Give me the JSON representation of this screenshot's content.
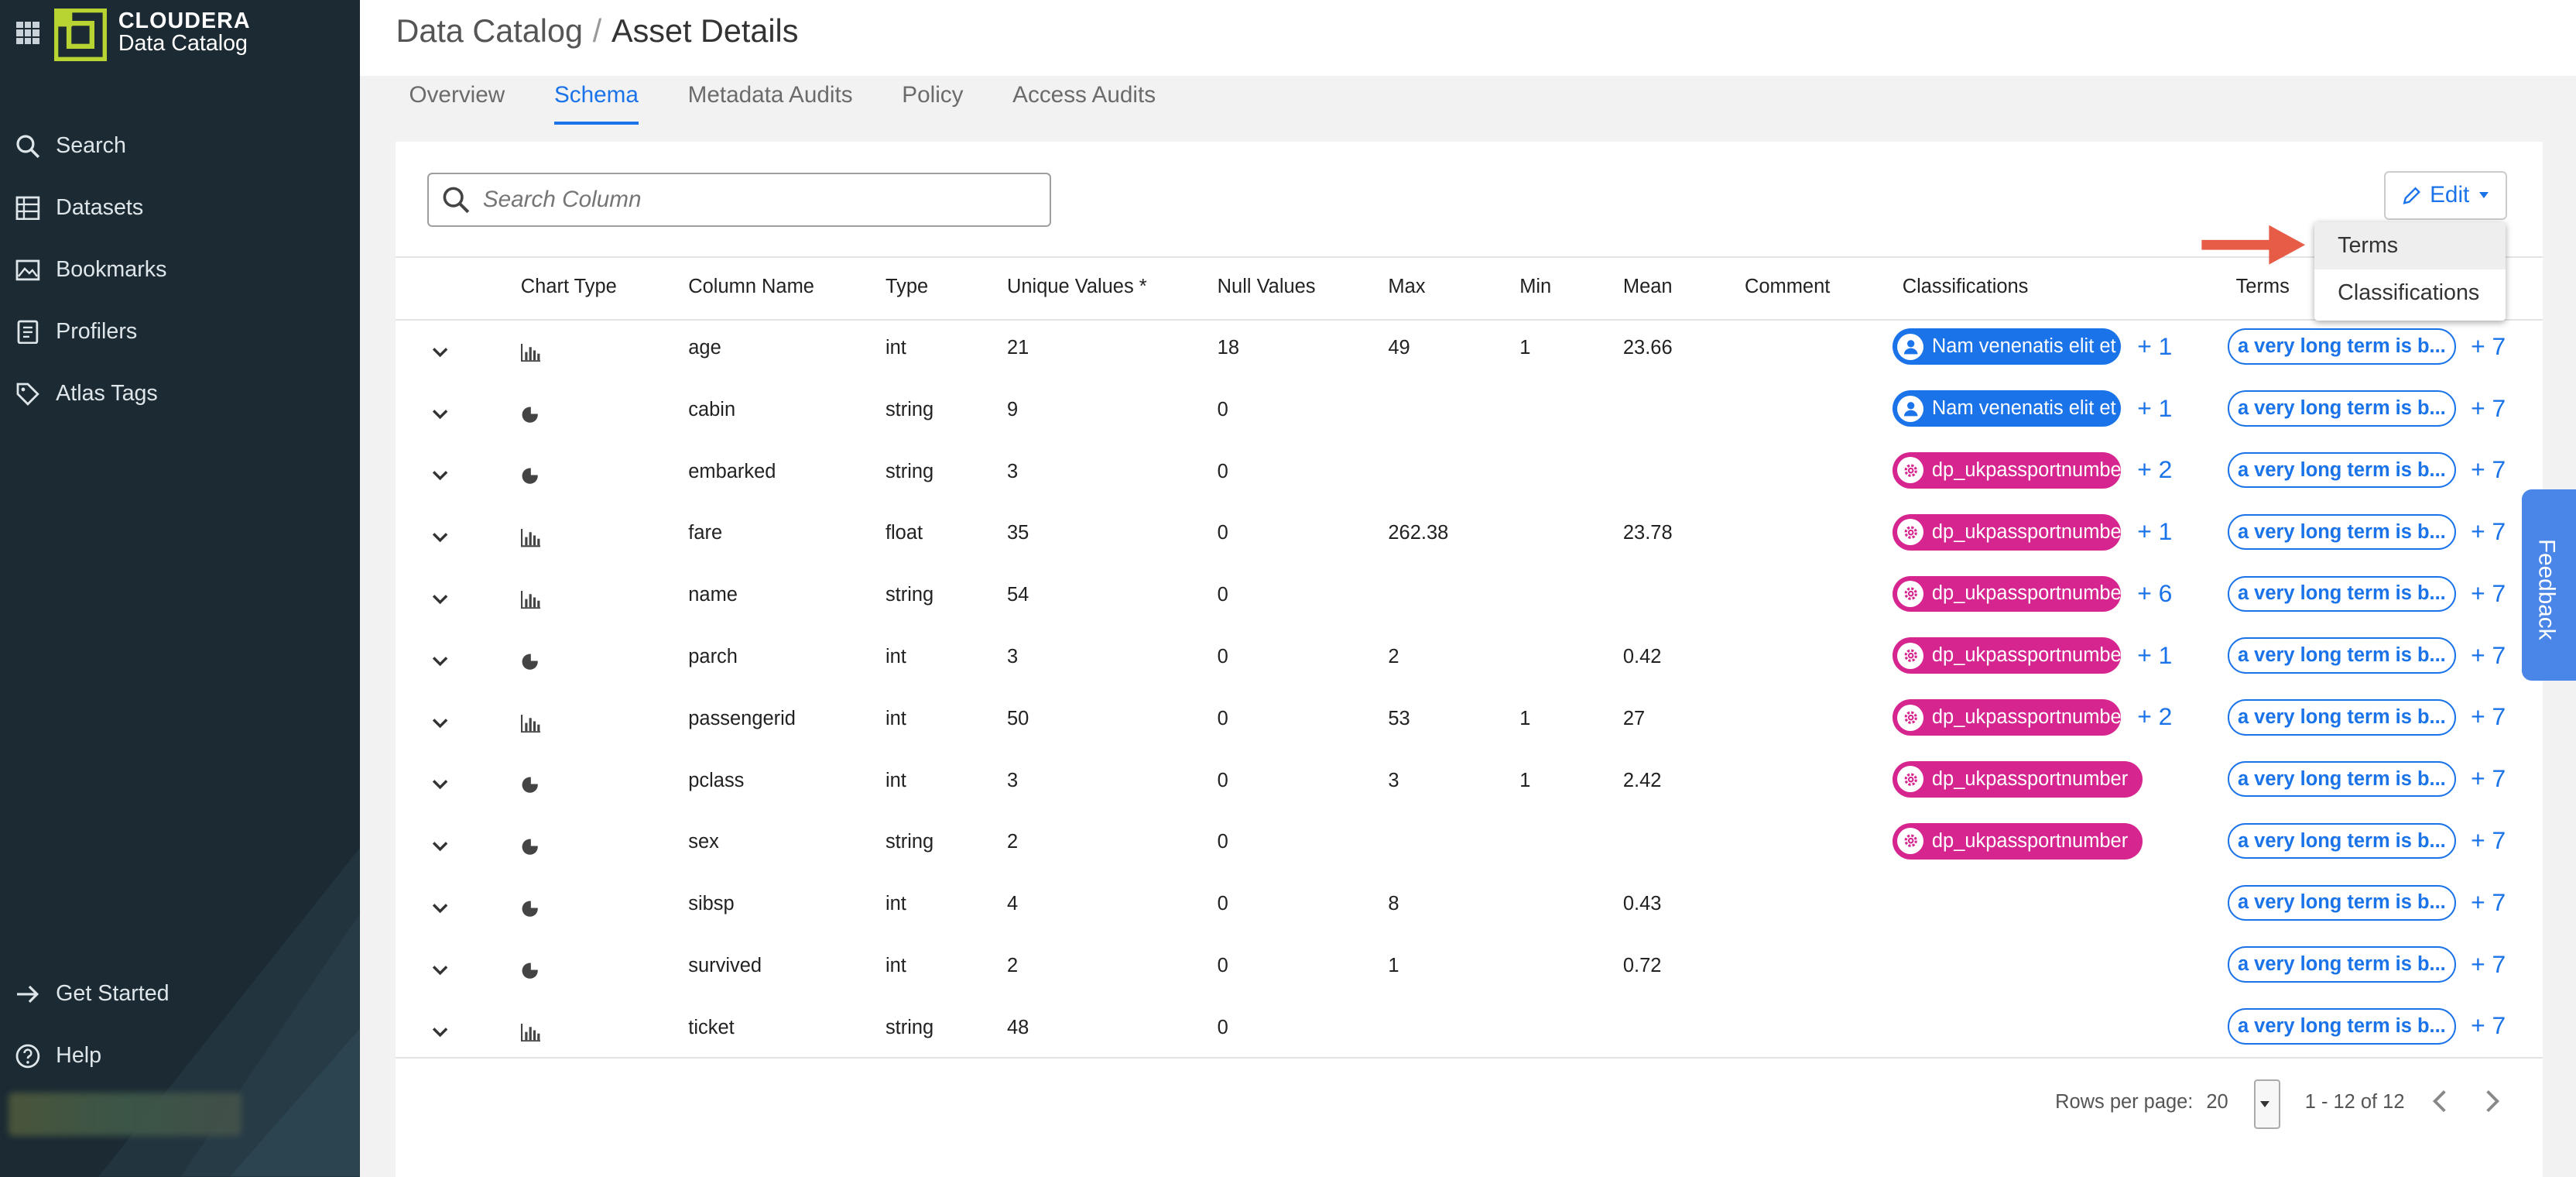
{
  "app": {
    "brand_line1": "CLOUDERA",
    "brand_line2": "Data Catalog"
  },
  "sidebar": {
    "items": [
      {
        "label": "Search",
        "icon": "search-icon"
      },
      {
        "label": "Datasets",
        "icon": "datasets-icon"
      },
      {
        "label": "Bookmarks",
        "icon": "bookmarks-icon"
      },
      {
        "label": "Profilers",
        "icon": "profilers-icon"
      },
      {
        "label": "Atlas Tags",
        "icon": "tag-icon"
      }
    ],
    "bottom_items": [
      {
        "label": "Get Started",
        "icon": "arrow-right-icon"
      },
      {
        "label": "Help",
        "icon": "help-icon"
      }
    ]
  },
  "header": {
    "breadcrumb_root": "Data Catalog",
    "breadcrumb_sep": "/",
    "breadcrumb_current": "Asset Details"
  },
  "tabs": [
    {
      "label": "Overview",
      "active": false
    },
    {
      "label": "Schema",
      "active": true
    },
    {
      "label": "Metadata Audits",
      "active": false
    },
    {
      "label": "Policy",
      "active": false
    },
    {
      "label": "Access Audits",
      "active": false
    }
  ],
  "search": {
    "placeholder": "Search Column"
  },
  "edit": {
    "label": "Edit"
  },
  "dropdown": {
    "items": [
      "Terms",
      "Classifications"
    ]
  },
  "table": {
    "headers": [
      "Chart Type",
      "Column Name",
      "Type",
      "Unique Values *",
      "Null Values",
      "Max",
      "Min",
      "Mean",
      "Comment",
      "Classifications",
      "Terms"
    ],
    "rows": [
      {
        "chart": "bar",
        "name": "age",
        "type": "int",
        "unique": "21",
        "nulls": "18",
        "max": "49",
        "min": "1",
        "mean": "23.66",
        "comment": "",
        "class": "Nam venenatis elit et ...",
        "class_kind": "blue",
        "class_more": "+ 1",
        "term": "a very long term is b...",
        "term_more": "+ 7"
      },
      {
        "chart": "pie",
        "name": "cabin",
        "type": "string",
        "unique": "9",
        "nulls": "0",
        "max": "",
        "min": "",
        "mean": "",
        "comment": "",
        "class": "Nam venenatis elit et ...",
        "class_kind": "blue",
        "class_more": "+ 1",
        "term": "a very long term is b...",
        "term_more": "+ 7"
      },
      {
        "chart": "pie",
        "name": "embarked",
        "type": "string",
        "unique": "3",
        "nulls": "0",
        "max": "",
        "min": "",
        "mean": "",
        "comment": "",
        "class": "dp_ukpassportnumber",
        "class_kind": "pink",
        "class_more": "+ 2",
        "term": "a very long term is b...",
        "term_more": "+ 7"
      },
      {
        "chart": "bar",
        "name": "fare",
        "type": "float",
        "unique": "35",
        "nulls": "0",
        "max": "262.38",
        "min": "",
        "mean": "23.78",
        "comment": "",
        "class": "dp_ukpassportnumber",
        "class_kind": "pink",
        "class_more": "+ 1",
        "term": "a very long term is b...",
        "term_more": "+ 7"
      },
      {
        "chart": "bar",
        "name": "name",
        "type": "string",
        "unique": "54",
        "nulls": "0",
        "max": "",
        "min": "",
        "mean": "",
        "comment": "",
        "class": "dp_ukpassportnumber",
        "class_kind": "pink",
        "class_more": "+ 6",
        "term": "a very long term is b...",
        "term_more": "+ 7"
      },
      {
        "chart": "pie",
        "name": "parch",
        "type": "int",
        "unique": "3",
        "nulls": "0",
        "max": "2",
        "min": "",
        "mean": "0.42",
        "comment": "",
        "class": "dp_ukpassportnumber",
        "class_kind": "pink",
        "class_more": "+ 1",
        "term": "a very long term is b...",
        "term_more": "+ 7"
      },
      {
        "chart": "bar",
        "name": "passengerid",
        "type": "int",
        "unique": "50",
        "nulls": "0",
        "max": "53",
        "min": "1",
        "mean": "27",
        "comment": "",
        "class": "dp_ukpassportnumber",
        "class_kind": "pink",
        "class_more": "+ 2",
        "term": "a very long term is b...",
        "term_more": "+ 7"
      },
      {
        "chart": "pie",
        "name": "pclass",
        "type": "int",
        "unique": "3",
        "nulls": "0",
        "max": "3",
        "min": "1",
        "mean": "2.42",
        "comment": "",
        "class": "dp_ukpassportnumber",
        "class_kind": "pink",
        "class_more": "",
        "term": "a very long term is b...",
        "term_more": "+ 7"
      },
      {
        "chart": "pie",
        "name": "sex",
        "type": "string",
        "unique": "2",
        "nulls": "0",
        "max": "",
        "min": "",
        "mean": "",
        "comment": "",
        "class": "dp_ukpassportnumber",
        "class_kind": "pink",
        "class_more": "",
        "term": "a very long term is b...",
        "term_more": "+ 7"
      },
      {
        "chart": "pie",
        "name": "sibsp",
        "type": "int",
        "unique": "4",
        "nulls": "0",
        "max": "8",
        "min": "",
        "mean": "0.43",
        "comment": "",
        "class": "",
        "class_kind": "",
        "class_more": "",
        "term": "a very long term is b...",
        "term_more": "+ 7"
      },
      {
        "chart": "pie",
        "name": "survived",
        "type": "int",
        "unique": "2",
        "nulls": "0",
        "max": "1",
        "min": "",
        "mean": "0.72",
        "comment": "",
        "class": "",
        "class_kind": "",
        "class_more": "",
        "term": "a very long term is b...",
        "term_more": "+ 7"
      },
      {
        "chart": "bar",
        "name": "ticket",
        "type": "string",
        "unique": "48",
        "nulls": "0",
        "max": "",
        "min": "",
        "mean": "",
        "comment": "",
        "class": "",
        "class_kind": "",
        "class_more": "",
        "term": "a very long term is b...",
        "term_more": "+ 7"
      }
    ]
  },
  "pagination": {
    "rows_per_page_label": "Rows per page:",
    "rows_per_page": "20",
    "range": "1 - 12 of 12"
  },
  "feedback": {
    "label": "Feedback"
  },
  "colors": {
    "sidebar": "#1b2a33",
    "accent": "#1a73e8",
    "pink": "#d6258f",
    "logo": "#b8d432",
    "arrow": "#e5533d"
  }
}
